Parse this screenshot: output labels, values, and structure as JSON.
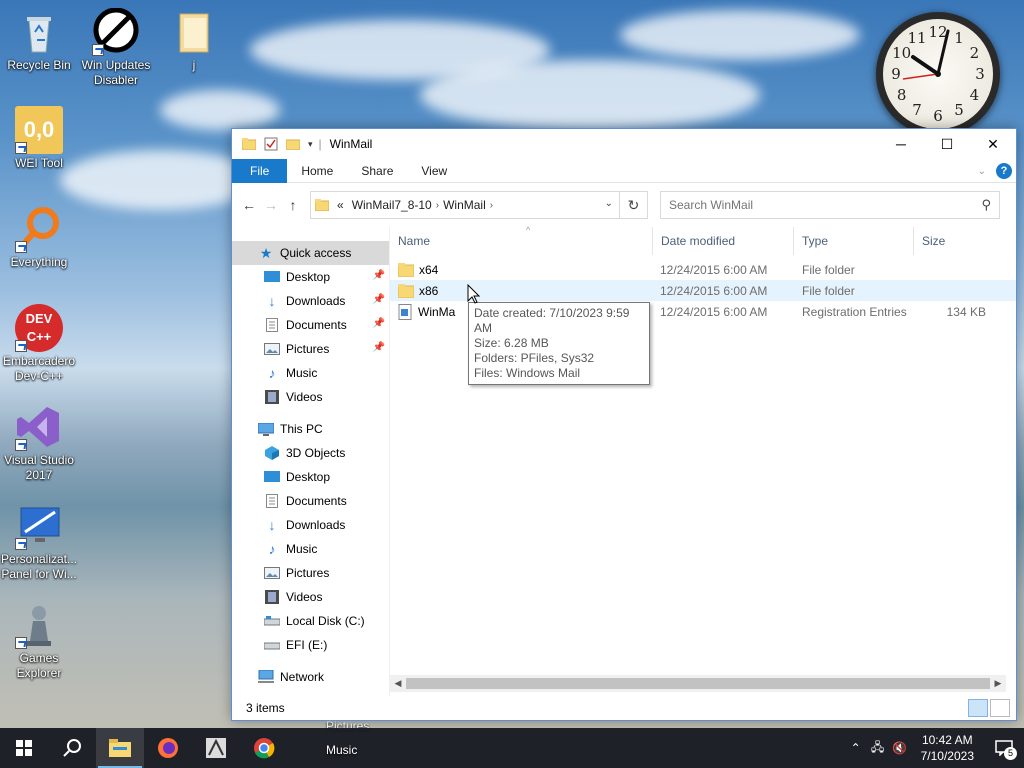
{
  "desktop": {
    "icons": [
      {
        "label": "Recycle Bin"
      },
      {
        "label": "Win Updates Disabler"
      },
      {
        "label": "j"
      },
      {
        "label": "WEI Tool",
        "glyph_text": "0,0"
      },
      {
        "label": "Everything"
      },
      {
        "label": "Embarcadero Dev-C++",
        "glyph_text": "DEV C++"
      },
      {
        "label": "Visual Studio 2017"
      },
      {
        "label": "Personalizat... Panel for Wi..."
      },
      {
        "label": "Games Explorer"
      }
    ],
    "peek": [
      "Pictures",
      "Music"
    ]
  },
  "clock_widget": {
    "numbers": [
      "12",
      "1",
      "2",
      "3",
      "4",
      "5",
      "6",
      "7",
      "8",
      "9",
      "10",
      "11"
    ]
  },
  "explorer": {
    "title": "WinMail",
    "ribbon_tabs": [
      "File",
      "Home",
      "Share",
      "View"
    ],
    "address": {
      "overflow": "«",
      "segments": [
        "WinMail7_8-10",
        "WinMail"
      ]
    },
    "search_placeholder": "Search WinMail",
    "nav": {
      "quick_access": "Quick access",
      "quick_items": [
        "Desktop",
        "Downloads",
        "Documents",
        "Pictures",
        "Music",
        "Videos"
      ],
      "this_pc": "This PC",
      "pc_items": [
        "3D Objects",
        "Desktop",
        "Documents",
        "Downloads",
        "Music",
        "Pictures",
        "Videos",
        "Local Disk (C:)",
        "EFI (E:)"
      ],
      "network": "Network"
    },
    "columns": [
      "Name",
      "Date modified",
      "Type",
      "Size"
    ],
    "files": [
      {
        "name": "x64",
        "date": "12/24/2015 6:00 AM",
        "type": "File folder",
        "size": ""
      },
      {
        "name": "x86",
        "date": "12/24/2015 6:00 AM",
        "type": "File folder",
        "size": ""
      },
      {
        "name": "WinMa",
        "date": "12/24/2015 6:00 AM",
        "type": "Registration Entries",
        "size": "134 KB"
      }
    ],
    "status": "3 items",
    "tooltip": [
      "Date created: 7/10/2023 9:59 AM",
      "Size: 6.28 MB",
      "Folders: PFiles, Sys32",
      "Files: Windows Mail"
    ]
  },
  "taskbar": {
    "time": "10:42 AM",
    "date": "7/10/2023",
    "notifications": "5"
  },
  "colors": {
    "accent": "#1979ca",
    "selection": "#e5f3ff",
    "folder": "#f8d775"
  }
}
